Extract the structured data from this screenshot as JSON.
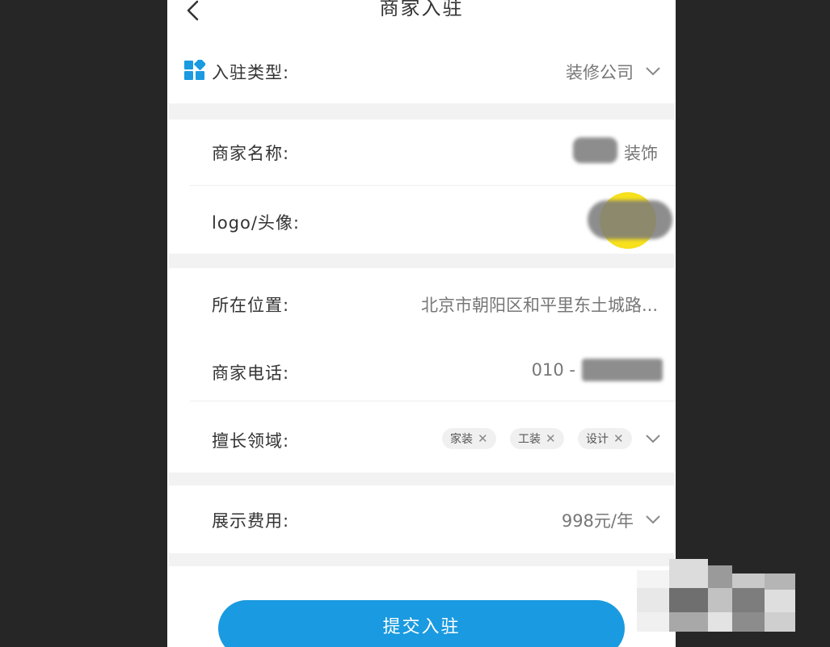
{
  "nav": {
    "title": "商家入驻"
  },
  "form": {
    "type_label": "入驻类型:",
    "type_value": "装修公司",
    "name_label": "商家名称:",
    "name_value_suffix": "装饰",
    "logo_label": "logo/头像:",
    "location_label": "所在位置:",
    "location_value": "北京市朝阳区和平里东土城路...",
    "phone_label": "商家电话:",
    "phone_prefix": "010 -",
    "field_label": "擅长领域:",
    "field_tags": [
      "家装",
      "工装",
      "设计"
    ],
    "fee_label": "展示费用:",
    "fee_value": "998元/年"
  },
  "submit_label": "提交入驻",
  "colors": {
    "accent": "#1a9ae0",
    "background": "#262626",
    "section_gap": "#f2f2f2",
    "highlight": "#f7e01c"
  },
  "icons": [
    "back-arrow-icon",
    "category-grid-icon",
    "chevron-down-icon",
    "tag-remove-icon"
  ]
}
